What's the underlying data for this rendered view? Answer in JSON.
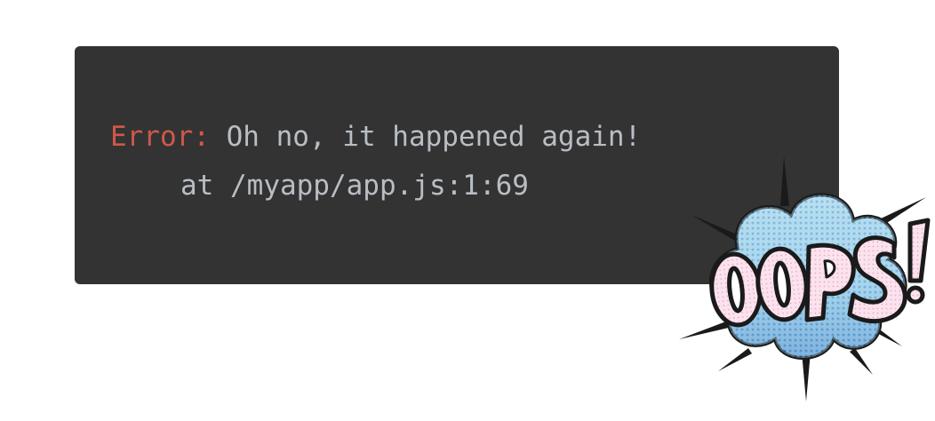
{
  "error": {
    "label": "Error:",
    "message": " Oh no, it happened again!",
    "stack": "at /myapp/app.js:1:69"
  },
  "sticker": {
    "text": "OOPS!",
    "icon": "oops-comic-burst-icon",
    "colors": {
      "cloud": "#a9d8ec",
      "cloud_dots": "#3d7fc0",
      "letters": "#fbe3ee",
      "outline": "#1a1a1a"
    }
  },
  "colors": {
    "background": "#ffffff",
    "terminal_bg": "#333333",
    "error_label": "#d0584a",
    "text": "#b9bec5"
  }
}
